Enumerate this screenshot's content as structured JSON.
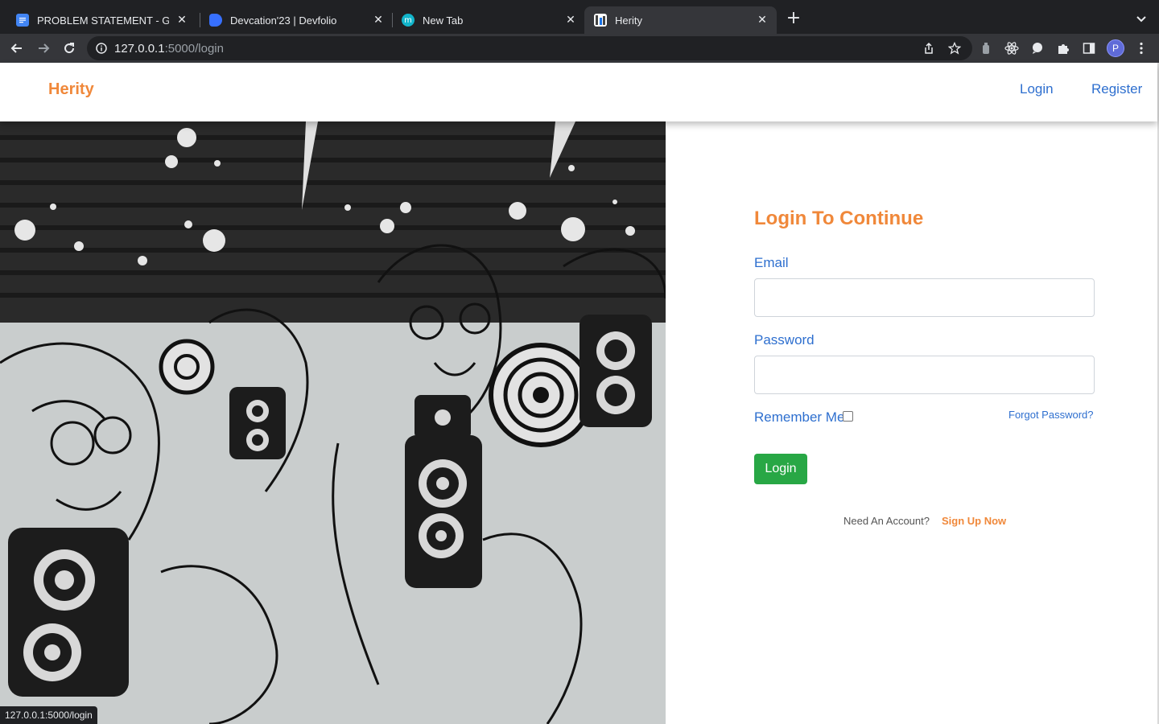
{
  "browser": {
    "tabs": [
      {
        "title": "PROBLEM STATEMENT - Goog",
        "icon": "google-docs-icon",
        "color": "#4285f4"
      },
      {
        "title": "Devcation'23 | Devfolio",
        "icon": "devfolio-icon",
        "color": "#3770ff"
      },
      {
        "title": "New Tab",
        "icon": "m-icon",
        "color": "#12b5cb",
        "glyph": "m"
      },
      {
        "title": "Herity",
        "icon": "herity-icon",
        "active": true
      }
    ],
    "url_host": "127.0.0.1",
    "url_path": ":5000/login",
    "profile_initial": "P",
    "status_url": "127.0.0.1:5000/login"
  },
  "header": {
    "brand": "Herity",
    "nav": {
      "login": "Login",
      "register": "Register"
    }
  },
  "form": {
    "title": "Login To Continue",
    "email_label": "Email",
    "email_value": "",
    "password_label": "Password",
    "password_value": "",
    "remember_label": "Remember Me",
    "remember_checked": false,
    "forgot_link": "Forgot Password?",
    "submit_label": "Login",
    "need_account": "Need An Account?",
    "signup_link": "Sign Up Now"
  },
  "colors": {
    "brand_orange": "#f0883a",
    "link_blue": "#2e6fcf",
    "button_green": "#28a745",
    "chrome_dark": "#202124"
  }
}
